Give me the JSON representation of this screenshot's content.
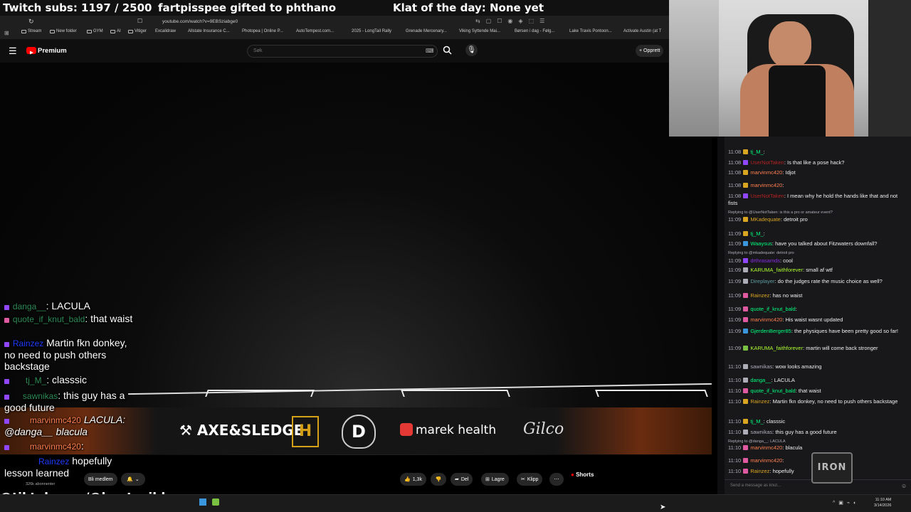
{
  "overlay": {
    "subs": "Twitch subs: 1197 / 2500",
    "gift": "fartpisspee gifted to phthano",
    "klat": "Klat of the day: None yet",
    "tiktok": "@tiktok.com/@knutspild"
  },
  "browser": {
    "url": "youtube.com/watch?v=9EBSziabge0",
    "bookmarks": [
      "Stream",
      "New folder",
      "GYM",
      "AI",
      "Vitiger",
      "Excalidraw",
      "Allstate Insurance C...",
      "Photopea | Online P...",
      "AutoTempest.com...",
      "2025 - LongTail Rally",
      "Grenade Mercenary...",
      "Viking Syttende Mai...",
      "Børsen i dag - Følg...",
      "Lake Travis Pontoon...",
      "Activate Austin (at T"
    ]
  },
  "youtube": {
    "logo": "Premium",
    "search_placeholder": "Søk",
    "create_label": "Opprett",
    "channel_subs": "326k abonnenter",
    "member_label": "Bli medlem",
    "like_count": "1,3k",
    "share_label": "Del",
    "save_label": "Lagre",
    "clip_label": "Klipp",
    "shorts_label": "Shorts"
  },
  "sponsors": [
    "AXE&SLEDGE",
    "HOSTILE",
    "marek health",
    "Gilco"
  ],
  "video_chat": [
    {
      "user": "danga__",
      "text": "LACULA",
      "color": "#2e8b57"
    },
    {
      "user": "quote_if_knut_bald",
      "text": "that waist",
      "color": "#2e8b57"
    },
    {
      "user": "Rainzez",
      "text": "Martin fkn donkey, no need to push others backstage",
      "color": "#1e3aff"
    },
    {
      "user": "tj_M_",
      "text": "classsic",
      "color": "#2e8b57"
    },
    {
      "user": "sawnikas",
      "text": "this guy has a good future",
      "color": "#2e8b57"
    },
    {
      "user": "marvinmc420",
      "text": "LACULA: @danga__ blacula",
      "color": "#ff7f50"
    },
    {
      "user": "marvinmc420",
      "text": "",
      "color": "#ff7f50"
    },
    {
      "user": "Rainzez",
      "text": "hopefully lesson learned",
      "color": "#1e3aff"
    }
  ],
  "chat": {
    "messages": [
      {
        "time": "11:08",
        "user": "tj_M_",
        "text": "",
        "color": "#00ff7f"
      },
      {
        "time": "11:08",
        "user": "UserNotTaken",
        "text": "Is that like a pose hack?",
        "color": "#b22222"
      },
      {
        "time": "11:08",
        "user": "marvinmc420",
        "text": "Idjot",
        "color": "#ff7f50"
      },
      {
        "time": "11:08",
        "user": "marvinmc420",
        "text": "",
        "color": "#ff7f50"
      },
      {
        "time": "11:08",
        "user": "UserNotTaken",
        "text": "I mean why he hold the hands like that and not fists",
        "color": "#b22222"
      },
      {
        "time": "11:09",
        "user": "MKadequate",
        "text": "detroit pro",
        "color": "#daa520"
      },
      {
        "time": "11:09",
        "user": "tj_M_",
        "text": "",
        "color": "#00ff7f"
      },
      {
        "time": "11:09",
        "user": "Waaysus",
        "text": "have you talked about Fitzwaters downfall?",
        "color": "#00ff7f"
      },
      {
        "time": "11:09",
        "user": "drthrasamds",
        "text": "cool",
        "color": "#8a2be2"
      },
      {
        "time": "11:09",
        "user": "KARUMA_faithforever",
        "text": "small af wtf",
        "color": "#adff2f"
      },
      {
        "time": "11:09",
        "user": "Direplayer",
        "text": "do the judges rate the music choice as well?",
        "color": "#5f9ea0"
      },
      {
        "time": "11:09",
        "user": "Rainzez",
        "text": "has no waist",
        "color": "#daa520"
      },
      {
        "time": "11:09",
        "user": "quote_if_knut_bald",
        "text": "",
        "color": "#00ff7f"
      },
      {
        "time": "11:09",
        "user": "marvinmc420",
        "text": "His waist wasnt updated",
        "color": "#ff7f50"
      },
      {
        "time": "11:09",
        "user": "GjerdenBerger85",
        "text": "the physiques have been pretty good so far!",
        "color": "#00ff7f"
      },
      {
        "time": "11:09",
        "user": "KARUMA_faithforever",
        "text": "martin will come back stronger",
        "color": "#adff2f"
      },
      {
        "time": "11:10",
        "user": "sawnikas",
        "text": "wow looks amazing",
        "color": "#adadb8"
      },
      {
        "time": "11:10",
        "user": "danga__",
        "text": "LACULA",
        "color": "#00ff7f"
      },
      {
        "time": "11:10",
        "user": "quote_if_knut_bald",
        "text": "that waist",
        "color": "#00ff7f"
      },
      {
        "time": "11:10",
        "user": "Rainzez",
        "text": "Martin fkn donkey, no need to push others backstage",
        "color": "#daa520"
      },
      {
        "time": "11:10",
        "user": "tj_M_",
        "text": "classsic",
        "color": "#00ff7f"
      },
      {
        "time": "11:10",
        "user": "sawnikas",
        "text": "this guy has a good future",
        "color": "#adadb8"
      },
      {
        "time": "11:10",
        "user": "marvinmc420",
        "text": "blacula",
        "color": "#ff7f50"
      },
      {
        "time": "11:10",
        "user": "marvinmc420",
        "text": "",
        "color": "#ff7f50"
      },
      {
        "time": "11:10",
        "user": "Rainzez",
        "text": "hopefully",
        "color": "#daa520"
      }
    ],
    "replies": [
      "Replying to @UserNotTaken: is this a pro or amateur event?",
      "Replying to @mkadequate: detroit pro",
      "Replying to @danga__: LACULA"
    ],
    "input_placeholder": "Send a message as knut..."
  },
  "taskbar": {
    "time": "11:10 AM",
    "date": "3/14/2026"
  },
  "colors": {
    "twitch_purple": "#9147ff",
    "yt_red": "#ff0000",
    "chat_bg": "#18181b"
  }
}
